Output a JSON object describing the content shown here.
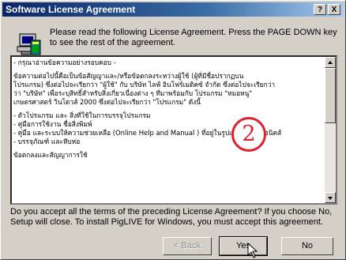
{
  "window": {
    "title": "Software License Agreement",
    "help_label": "?",
    "close_label": "X"
  },
  "instructions": "Please read the following License Agreement.  Press the PAGE DOWN key to see the rest of the agreement.",
  "license_lines": [
    "- กรุณาอ่านข้อความอย่างรอบคอบ -",
    "",
    "   ข้อความต่อไปนี้คือเป็นข้อสัญญาและ/หรือข้อตกลงระหว่างผู้ใช้ (ผู้ที่มีชื่อปรากฏบน",
    "โปรแกรม) ซึ่งต่อไปจะเรียกว่า \"ผู้ใช้\" กับ บริษัท ไลฟ์ อินโฟร์เมติคซ์ จำกัด ซึ่งต่อไปจะเรียกว่า",
    "ว่า \"บริษัท\" เพื่อระบุสิทธิ์สำหรับสิ่งเกี่ยวเนื่องต่าง ๆ ที่มาพร้อมกับ โปรแกรม \"หมอหนู\"",
    "เกษตรศาสตร์ วินโดวส์ 2000 ซึ่งต่อไปจะเรียกว่า \"โปรแกรม\" ดังนี้",
    "",
    "- ตัวโปรแกรม และ สิ่งที่ใช้ในการบรรจุโปรแกรม",
    "- คู่มือการใช้งาน ชื่อสิ่งพิมพ์",
    "- คู่มือ และระบบให้ความช่วยเหลือ (Online Help and Manual ) ที่อยู่ในรูปแบบอิเลคทรอนิคส์",
    "- บรรจุภัณฑ์ และหีบห่อ",
    "",
    "ข้อตกลงและสัญญาการใช้"
  ],
  "annotation_number": "2",
  "question": "Do you accept all the terms of the preceding License Agreement?  If you choose No,  Setup will close.  To install PigLIVE for Windows, you must accept this agreement.",
  "buttons": {
    "back": "< Back",
    "yes": "Yes",
    "no": "No"
  },
  "colors": {
    "title_bar": "#0a246a",
    "dialog_face": "#d4d0c8",
    "annotation_red": "#e0202e"
  }
}
